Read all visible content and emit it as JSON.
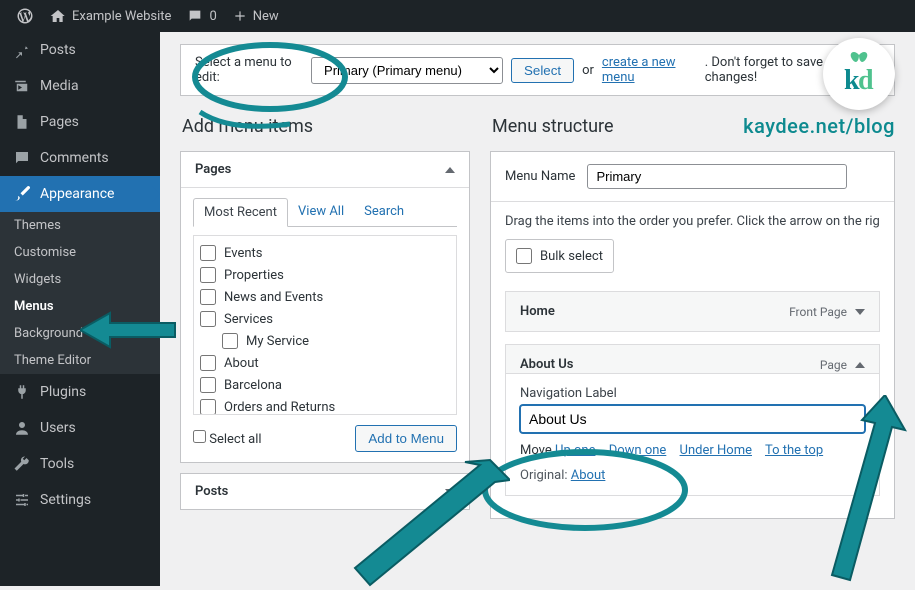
{
  "topbar": {
    "site_name": "Example Website",
    "comments_count": "0",
    "new_label": "New"
  },
  "sidebar": {
    "items": [
      {
        "label": "Posts"
      },
      {
        "label": "Media"
      },
      {
        "label": "Pages"
      },
      {
        "label": "Comments"
      },
      {
        "label": "Appearance"
      },
      {
        "label": "Plugins"
      },
      {
        "label": "Users"
      },
      {
        "label": "Tools"
      },
      {
        "label": "Settings"
      }
    ],
    "appearance_sub": [
      {
        "label": "Themes"
      },
      {
        "label": "Customise"
      },
      {
        "label": "Widgets"
      },
      {
        "label": "Menus"
      },
      {
        "label": "Background"
      },
      {
        "label": "Theme Editor"
      }
    ]
  },
  "edit_bar": {
    "prefix": "Select a menu to edit:",
    "selected": "Primary (Primary menu)",
    "select_btn": "Select",
    "or": "or",
    "create_link": "create a new menu",
    "suffix": ". Don't forget to save your changes!"
  },
  "left_col": {
    "heading": "Add menu items",
    "pages_title": "Pages",
    "tabs": {
      "recent": "Most Recent",
      "view_all": "View All",
      "search": "Search"
    },
    "pages": [
      "Events",
      "Properties",
      "News and Events",
      "Services",
      "My Service",
      "About",
      "Barcelona",
      "Orders and Returns"
    ],
    "select_all": "Select all",
    "add_btn": "Add to Menu",
    "posts_title": "Posts"
  },
  "right_col": {
    "heading": "Menu structure",
    "menu_name_label": "Menu Name",
    "menu_name_value": "Primary",
    "drag_text": "Drag the items into the order you prefer. Click the arrow on the right of the item to reveal options.",
    "bulk_select": "Bulk select",
    "item_home": {
      "title": "Home",
      "type": "Front Page"
    },
    "item_about": {
      "title": "About Us",
      "type": "Page",
      "nav_label_text": "Navigation Label",
      "nav_label_value": "About Us",
      "move_label": "Move",
      "move_up": "Up one",
      "move_down": "Down one",
      "move_under": "Under Home",
      "move_top": "To the top",
      "original_label": "Original:",
      "original_link": "About"
    }
  },
  "watermark": {
    "url": "kaydee.net/blog"
  }
}
